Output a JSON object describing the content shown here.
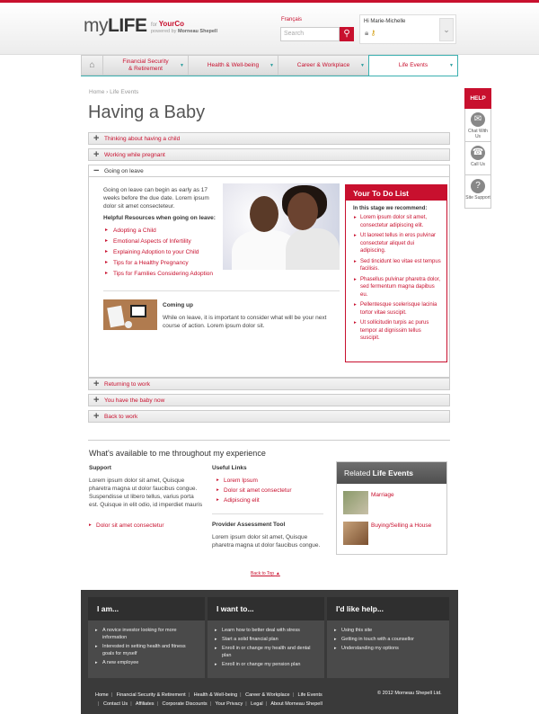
{
  "header": {
    "logo_light": "my",
    "logo_bold": "LIFE",
    "for_prefix": "for",
    "company": "YourCo",
    "powered_by_prefix": "powered by",
    "powered_by": "Morneau Shepell",
    "language_link": "Français",
    "search_placeholder": "Search",
    "greeting": "Hi Marie-Michelle"
  },
  "nav": {
    "tabs": [
      {
        "label": "Financial Security\n& Retirement"
      },
      {
        "label": "Health & Well-being"
      },
      {
        "label": "Career & Workplace"
      },
      {
        "label": "Life Events"
      }
    ],
    "active_tab": "Life Events"
  },
  "breadcrumb": {
    "home": "Home",
    "sep": "›",
    "current": "Life Events"
  },
  "page_title": "Having a Baby",
  "accordion": {
    "top_items": [
      "Thinking about having a child",
      "Working while pregnant"
    ],
    "open_item": "Going on leave",
    "bottom_items": [
      "Returning to work",
      "You have the baby now",
      "Back to work"
    ]
  },
  "leave": {
    "intro": "Going on leave can begin as early as 17 weeks before the due date. Lorem ipsum dolor sit amet consecteteur.",
    "resources_heading": "Helpful Resources when going on leave:",
    "resources": [
      "Adopting a Child",
      "Emotional Aspects of Infertility",
      "Explaining Adoption to your Child",
      "Tips for a Healthy Pregnancy",
      "Tips for Families Considering Adoption"
    ],
    "coming_up_title": "Coming up",
    "coming_up_text": "While on leave, it is important to consider what will be your next course of action. Lorem ipsum dolor sit."
  },
  "todo": {
    "title": "Your To Do List",
    "subtitle": "In this stage we recommend:",
    "items": [
      "Lorem ipsum dolor sit amet, consectetur adipiscing elit.",
      "Ut laoreet tellus in eros pulvinar consectetur aliquet dui adipiscing.",
      "Sed tincidunt leo vitae est tempus facilisis.",
      "Phasellus pulvinar pharetra dolor, sed fermentum magna dapibus eu.",
      "Pellentesque scelerisque lacinia tortor vitae suscipit.",
      "Ut sollicitudin turpis ac purus tempor at dignissim tellus suscipit."
    ]
  },
  "experience": {
    "heading": "What's available to me throughout my experience",
    "support_heading": "Support",
    "support_text": "Lorem ipsum dolor sit amet, Quisque pharetra magna ut dolor faucibus congue. Suspendisse ut libero tellus, varius porta est. Quisque in elit odio, id imperdiet mauris",
    "support_link": "Dolor sit amet consectetur",
    "useful_heading": "Useful Links",
    "useful_links": [
      "Lorem Ipsum",
      "Dolor sit amet consectetur",
      "Adipiscing elit"
    ],
    "provider_heading": "Provider Assessment Tool",
    "provider_text": "Lorem ipsum dolor sit amet, Quisque pharetra magna ut dolor faucibus congue.",
    "related_prefix": "Related ",
    "related_bold": "Life Events",
    "related_items": [
      "Marriage",
      "Buying/Selling a House"
    ]
  },
  "back_to_top": "Back to Top",
  "footer": {
    "columns": [
      {
        "title": "I am...",
        "items": [
          "A novice investor looking for more information",
          "Interested in setting health and fitness goals for myself",
          "A new employee"
        ]
      },
      {
        "title": "I want to...",
        "items": [
          "Learn how to better deal with stress",
          "Start a solid financial plan",
          "Enroll in or change my health and dental plan",
          "Enroll in or change my pension plan"
        ]
      },
      {
        "title": "I'd like help...",
        "items": [
          "Using this site",
          "Getting in touch with a counsellor",
          "Understanding my options"
        ]
      }
    ],
    "links_row1": [
      "Home",
      "Financial Security & Retirement",
      "Health & Well-being",
      "Career & Workplace",
      "Life Events"
    ],
    "links_row2": [
      "Contact Us",
      "Affiliates",
      "Corporate Discounts",
      "Your Privacy",
      "Legal",
      "About Morneau Shepell"
    ],
    "copyright": "© 2012 Morneau Shepell Ltd."
  },
  "side": {
    "help": "HELP",
    "chat": "Chat With Us",
    "call": "Call Us",
    "support": "Site Support"
  },
  "colors": {
    "accent": "#c8102e",
    "teal": "#3bb0b0",
    "footer": "#3a3a3a"
  }
}
